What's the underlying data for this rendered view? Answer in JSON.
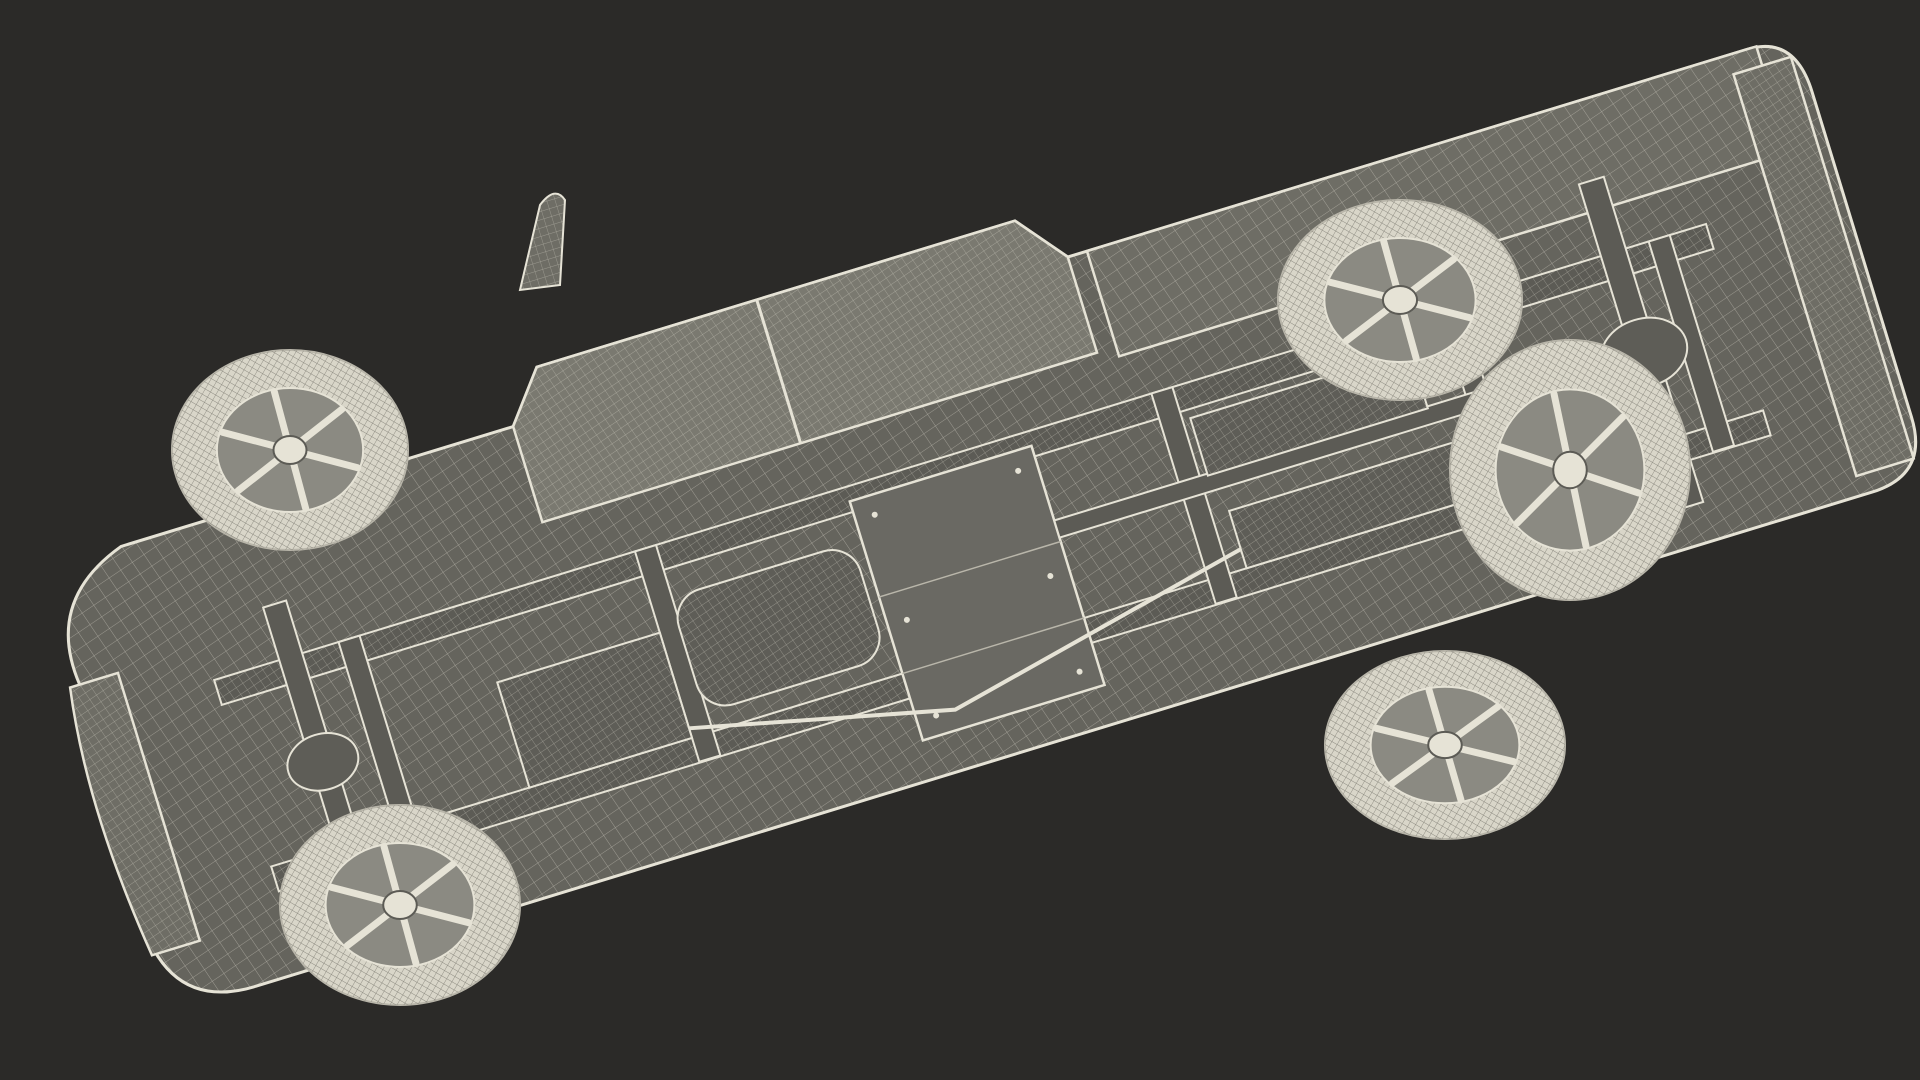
{
  "scene": {
    "background": "#2b2a28",
    "body_fill": "#65645d",
    "body_fill_light": "#7a7970",
    "panel_fill": "#6e6d65",
    "wire_color": "#e6e3d6",
    "wire_dim": "#b9b6aa",
    "tire_fill": "#d9d6c9",
    "rim_fill": "#8b8a82",
    "frame_fill": "#5c5b55",
    "object": "pickup-truck-wireframe-underside-view",
    "wheels": 5
  }
}
